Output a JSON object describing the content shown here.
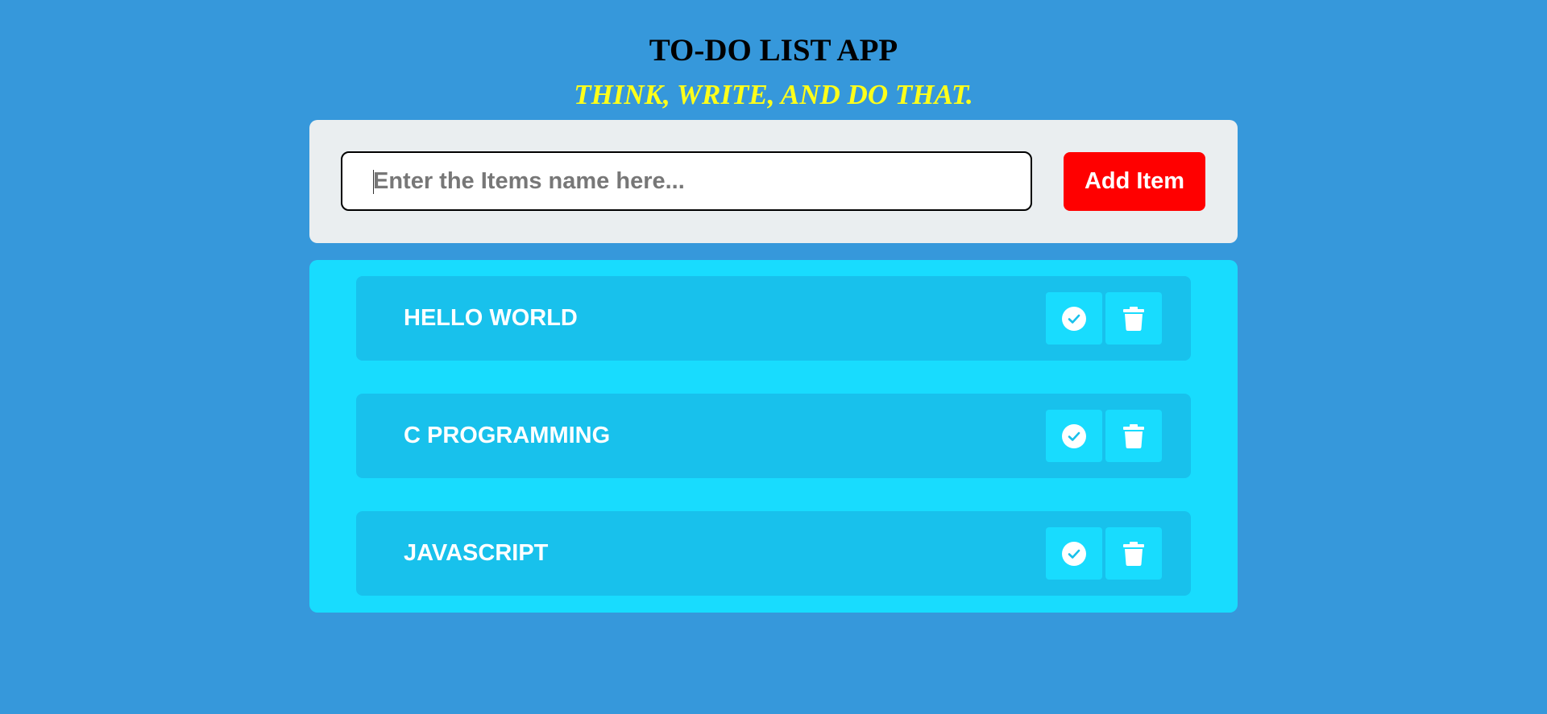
{
  "header": {
    "title": "TO-DO LIST APP",
    "subtitle": "THINK, WRITE, AND DO THAT."
  },
  "input_section": {
    "placeholder": "Enter the Items name here...",
    "value": "",
    "add_button_label": "Add Item"
  },
  "todo_list": {
    "items": [
      {
        "text": "HELLO WORLD",
        "actions": [
          "check-circle-icon",
          "trash-icon"
        ]
      },
      {
        "text": "C PROGRAMMING",
        "actions": [
          "check-circle-icon",
          "trash-icon"
        ]
      },
      {
        "text": "JAVASCRIPT",
        "actions": [
          "check-circle-icon",
          "trash-icon"
        ]
      }
    ]
  },
  "colors": {
    "background": "#3698db",
    "title": "#000000",
    "subtitle": "#ffff1a",
    "input_card": "#eaeef0",
    "add_button": "#ff0000",
    "list_card": "#18dcfe",
    "item_background": "#18c1ec",
    "item_text": "#ffffff"
  }
}
